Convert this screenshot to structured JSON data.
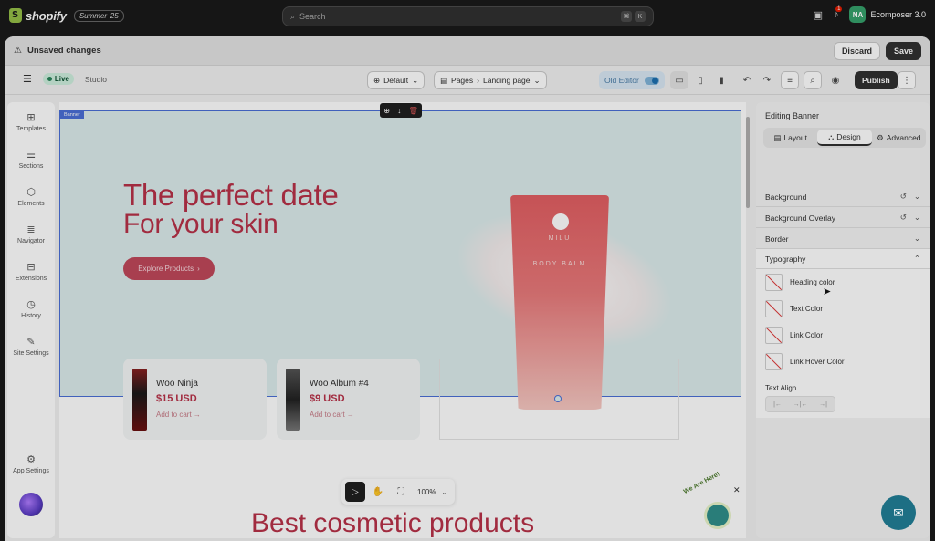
{
  "shopify": {
    "logo_text": "shopify",
    "edition": "Summer '25",
    "search_placeholder": "Search",
    "kbd1": "⌘",
    "kbd2": "K",
    "notif_count": "1",
    "store_initials": "NA",
    "store_name": "Ecomposer 3.0"
  },
  "unsaved": {
    "message": "Unsaved changes",
    "discard": "Discard",
    "save": "Save"
  },
  "toolbar": {
    "live": "Live",
    "studio": "Studio",
    "default": "Default",
    "pages": "Pages",
    "landing": "Landing page",
    "old_editor": "Old Editor",
    "publish": "Publish"
  },
  "rail": {
    "items": [
      "Templates",
      "Sections",
      "Elements",
      "Navigator",
      "Extensions",
      "History",
      "Site Settings"
    ],
    "app_settings": "App Settings"
  },
  "canvas": {
    "banner_tag": "Banner",
    "heading": "The perfect date",
    "subheading": "For your skin",
    "cta": "Explore Products",
    "tube_brand": "MILU",
    "tube_name": "BODY BALM",
    "products": [
      {
        "name": "Woo Ninja",
        "price": "$15 USD",
        "cart": "Add to cart"
      },
      {
        "name": "Woo Album #4",
        "price": "$9 USD",
        "cart": "Add to cart"
      }
    ],
    "bottom_title": "Best cosmetic products",
    "zoom": "100%",
    "we_are_here": "We Are Here!"
  },
  "panel": {
    "title": "Editing Banner",
    "tabs": [
      "Layout",
      "Design",
      "Advanced"
    ],
    "sections": [
      "Background",
      "Background Overlay",
      "Border",
      "Typography"
    ],
    "colors": [
      "Heading color",
      "Text Color",
      "Link Color",
      "Link Hover Color"
    ],
    "text_align_label": "Text Align"
  }
}
